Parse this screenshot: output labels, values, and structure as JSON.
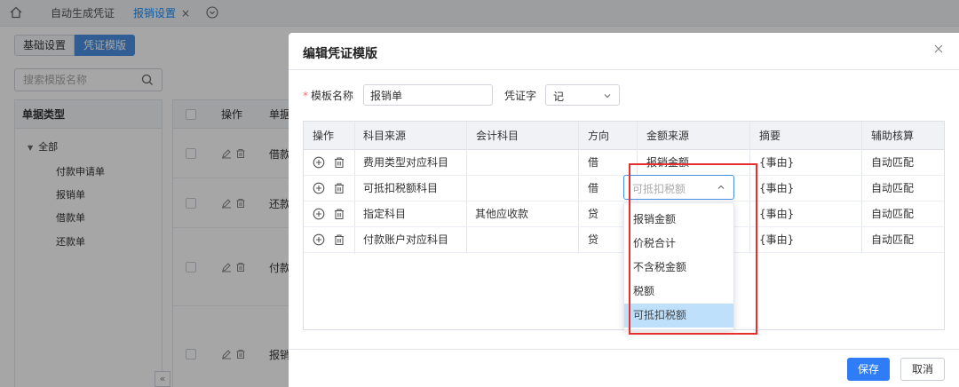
{
  "tabbar": {
    "tabs": [
      {
        "label": "自动生成凭证"
      },
      {
        "label": "报销设置"
      }
    ],
    "close_glyph": "×"
  },
  "segments": {
    "basic": "基础设置",
    "voucher": "凭证模版"
  },
  "search": {
    "placeholder": "搜索模版名称"
  },
  "tree": {
    "header": "单据类型",
    "root": "全部",
    "items": [
      "付款申请单",
      "报销单",
      "借款单",
      "还款单"
    ]
  },
  "bg_table": {
    "header_op": "操作",
    "header_doc": "单据",
    "row_texts": [
      "借款",
      "还款",
      "付款",
      "报销"
    ],
    "collapse_glyph": "«"
  },
  "dialog": {
    "title": "编辑凭证模版",
    "required_mark": "*",
    "name_label": "模板名称",
    "name_value": "报销单",
    "word_label": "凭证字",
    "word_value": "记",
    "columns": [
      "操作",
      "科目来源",
      "会计科目",
      "方向",
      "金额来源",
      "摘要",
      "辅助核算"
    ],
    "rows": [
      {
        "source": "费用类型对应科目",
        "account": "",
        "direction": "借",
        "amount": "报销金额",
        "summary": "{事由}",
        "aux": "自动匹配"
      },
      {
        "source": "可抵扣税额科目",
        "account": "",
        "direction": "借",
        "amount": "",
        "summary": "{事由}",
        "aux": "自动匹配"
      },
      {
        "source": "指定科目",
        "account": "其他应收款",
        "direction": "贷",
        "amount": "",
        "summary": "{事由}",
        "aux": "自动匹配"
      },
      {
        "source": "付款账户对应科目",
        "account": "",
        "direction": "贷",
        "amount": "",
        "summary": "{事由}",
        "aux": "自动匹配"
      }
    ],
    "amount_select": {
      "placeholder": "可抵扣税额",
      "options": [
        "报销金额",
        "价税合计",
        "不含税金额",
        "税额",
        "可抵扣税额"
      ],
      "selected": "可抵扣税额"
    },
    "save_label": "保存",
    "cancel_label": "取消"
  },
  "colors": {
    "primary": "#2e7cf6",
    "active_tab": "#1890ff",
    "highlight": "#e62f2f",
    "selected_option_bg": "#bfe0fb"
  }
}
